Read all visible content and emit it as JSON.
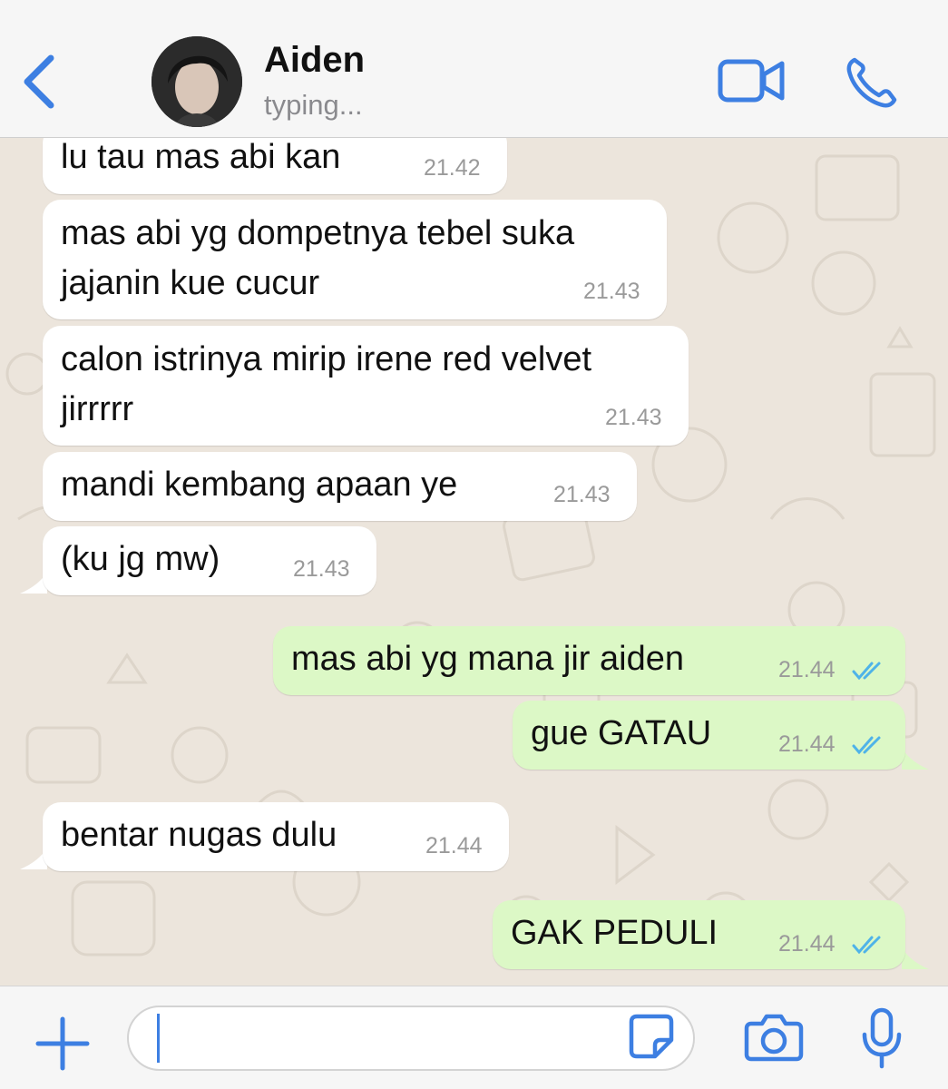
{
  "header": {
    "back_icon": "chevron-left-icon",
    "contact_name": "Aiden",
    "contact_status": "typing...",
    "video_icon": "video-camera-icon",
    "call_icon": "phone-icon"
  },
  "messages": [
    {
      "direction": "incoming",
      "text": "lu tau mas abi kan",
      "time": "21.42"
    },
    {
      "direction": "incoming",
      "lines": [
        "mas abi yg dompetnya tebel suka",
        "jajanin kue cucur"
      ],
      "time": "21.43"
    },
    {
      "direction": "incoming",
      "lines": [
        "calon istrinya mirip irene red velvet",
        "jirrrrr"
      ],
      "time": "21.43"
    },
    {
      "direction": "incoming",
      "text": "mandi kembang apaan ye",
      "time": "21.43"
    },
    {
      "direction": "incoming",
      "text": "(ku jg mw)",
      "time": "21.43"
    },
    {
      "direction": "outgoing",
      "text": "mas abi yg mana jir aiden",
      "time": "21.44",
      "status": "read"
    },
    {
      "direction": "outgoing",
      "text": "gue GATAU",
      "time": "21.44",
      "status": "read"
    },
    {
      "direction": "incoming",
      "text": "bentar nugas dulu",
      "time": "21.44"
    },
    {
      "direction": "outgoing",
      "text": "GAK PEDULI",
      "time": "21.44",
      "status": "read"
    }
  ],
  "input_bar": {
    "placeholder": "",
    "value": "",
    "icons": [
      "plus-icon",
      "sticker-icon",
      "camera-icon",
      "microphone-icon"
    ]
  },
  "colors": {
    "accent": "#3d7fe2",
    "incoming_bubble": "#ffffff",
    "outgoing_bubble": "#dcf8c6",
    "read_ticks": "#4fb3e8",
    "chat_background": "#ece5dc"
  }
}
